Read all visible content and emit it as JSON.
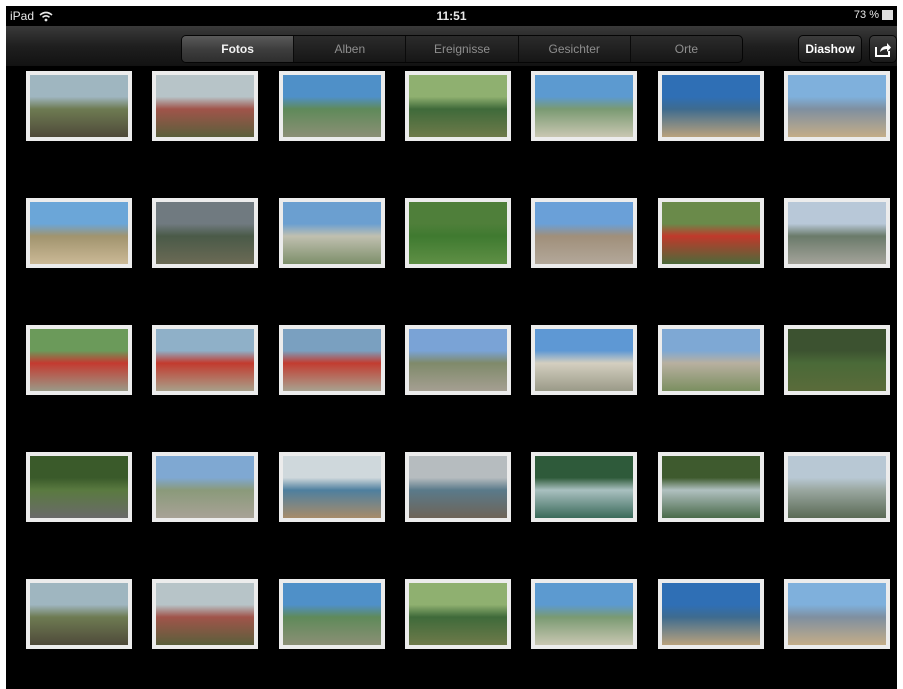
{
  "status_bar": {
    "device": "iPad",
    "time": "11:51",
    "battery": "73 %",
    "icons": [
      "wifi-icon",
      "battery-icon"
    ]
  },
  "toolbar": {
    "tabs": [
      {
        "label": "Fotos",
        "selected": true
      },
      {
        "label": "Alben",
        "selected": false
      },
      {
        "label": "Ereignisse",
        "selected": false
      },
      {
        "label": "Gesichter",
        "selected": false
      },
      {
        "label": "Orte",
        "selected": false
      }
    ],
    "slideshow_label": "Diashow",
    "share_icon": "share-icon"
  },
  "photos": {
    "columns": 7,
    "rows": 5,
    "styles": [
      {
        "sky": "#9fb6c0",
        "mid": "#6e7b52",
        "ground": "#4f4a3a"
      },
      {
        "sky": "#b7c4c8",
        "mid": "#a0544a",
        "ground": "#5a5f3b"
      },
      {
        "sky": "#4f90c8",
        "mid": "#5f8a5a",
        "ground": "#8b8f75"
      },
      {
        "sky": "#8fb070",
        "mid": "#3f6a3a",
        "ground": "#6e7a4a"
      },
      {
        "sky": "#5c9ad0",
        "mid": "#7a9a72",
        "ground": "#c9c7b2"
      },
      {
        "sky": "#2f6fb5",
        "mid": "#3e6b8f",
        "ground": "#b9a27d"
      },
      {
        "sky": "#7fb0dc",
        "mid": "#7f8fa0",
        "ground": "#c4ad88"
      },
      {
        "sky": "#6ba6d8",
        "mid": "#a1946e",
        "ground": "#cbb996"
      },
      {
        "sky": "#707a80",
        "mid": "#4a5a48",
        "ground": "#6b6a55"
      },
      {
        "sky": "#6b9fd0",
        "mid": "#c0c0b0",
        "ground": "#7d8f6a"
      },
      {
        "sky": "#4f7f3a",
        "mid": "#3f7a30",
        "ground": "#5f8f45"
      },
      {
        "sky": "#6aa0d8",
        "mid": "#a08f7a",
        "ground": "#b3a89a"
      },
      {
        "sky": "#6a8a4a",
        "mid": "#c0392b",
        "ground": "#4c6a3a"
      },
      {
        "sky": "#b8c8d8",
        "mid": "#6a7a6a",
        "ground": "#a4a39a"
      },
      {
        "sky": "#6b9a5a",
        "mid": "#c43a30",
        "ground": "#9a9a88"
      },
      {
        "sky": "#8fb0c8",
        "mid": "#c23a2e",
        "ground": "#a8a08a"
      },
      {
        "sky": "#7aa0c0",
        "mid": "#c23c30",
        "ground": "#a8a290"
      },
      {
        "sky": "#7aa3d6",
        "mid": "#7f8a6a",
        "ground": "#a59f92"
      },
      {
        "sky": "#5e98d4",
        "mid": "#d4cfc0",
        "ground": "#9a9a88"
      },
      {
        "sky": "#7ea8d4",
        "mid": "#b8b0a0",
        "ground": "#7b8f60"
      },
      {
        "sky": "#3c5230",
        "mid": "#4a6a38",
        "ground": "#5a6b3a"
      },
      {
        "sky": "#3a5a2a",
        "mid": "#5a7a40",
        "ground": "#6a6a6a"
      },
      {
        "sky": "#7fa8d2",
        "mid": "#8a9a7a",
        "ground": "#a8a296"
      },
      {
        "sky": "#cfd8dc",
        "mid": "#4e7f9f",
        "ground": "#a88c6a"
      },
      {
        "sky": "#b6bcbf",
        "mid": "#5a7a8a",
        "ground": "#6e6458"
      },
      {
        "sky": "#2e5a3a",
        "mid": "#a9c0c0",
        "ground": "#3a6a5a"
      },
      {
        "sky": "#3e5a2e",
        "mid": "#b0c0c0",
        "ground": "#4a6a4a"
      },
      {
        "sky": "#b8c8d4",
        "mid": "#9aa7a0",
        "ground": "#5a6a55"
      }
    ]
  }
}
